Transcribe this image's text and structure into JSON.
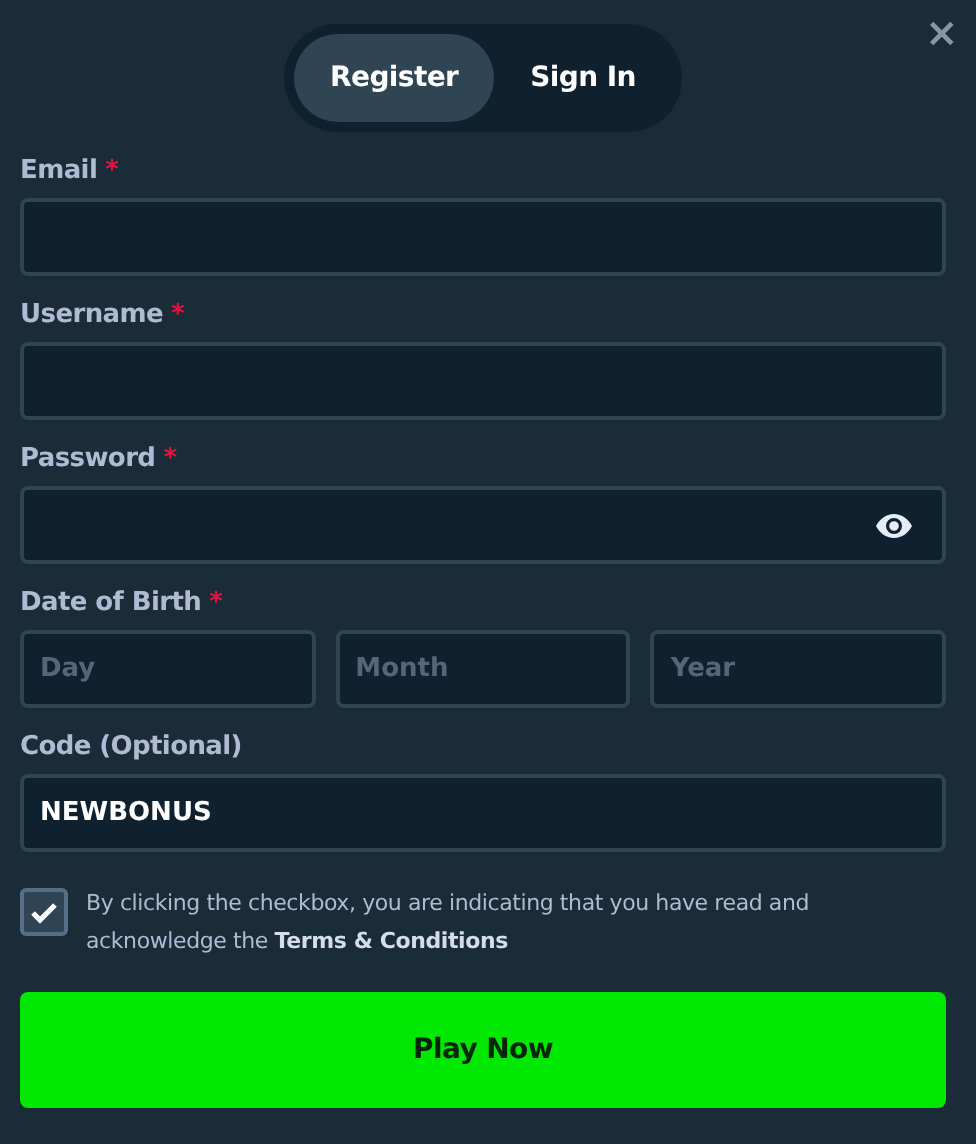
{
  "tabs": [
    {
      "label": "Register",
      "selected": true
    },
    {
      "label": "Sign In",
      "selected": false
    }
  ],
  "close": "×",
  "fields": [
    {
      "label": "Email",
      "required_mark": "*",
      "kind": "text"
    },
    {
      "label": "Username",
      "required_mark": "*",
      "kind": "text"
    },
    {
      "label": "Password",
      "required_mark": "*",
      "kind": "password"
    }
  ],
  "date_of_birth": {
    "label": "Date of Birth",
    "required_mark": "*",
    "parts": [
      {
        "placeholder": "Day"
      },
      {
        "placeholder": "Month"
      },
      {
        "placeholder": "Year"
      }
    ]
  },
  "code": {
    "label": "Code (Optional)",
    "value": "NEWBONUS",
    "kind": "text"
  },
  "terms": {
    "checked": true,
    "text": "By clicking the checkbox, you are indicating that you have read and acknowledge the",
    "link": "Terms & Conditions"
  },
  "submit": "Play Now"
}
